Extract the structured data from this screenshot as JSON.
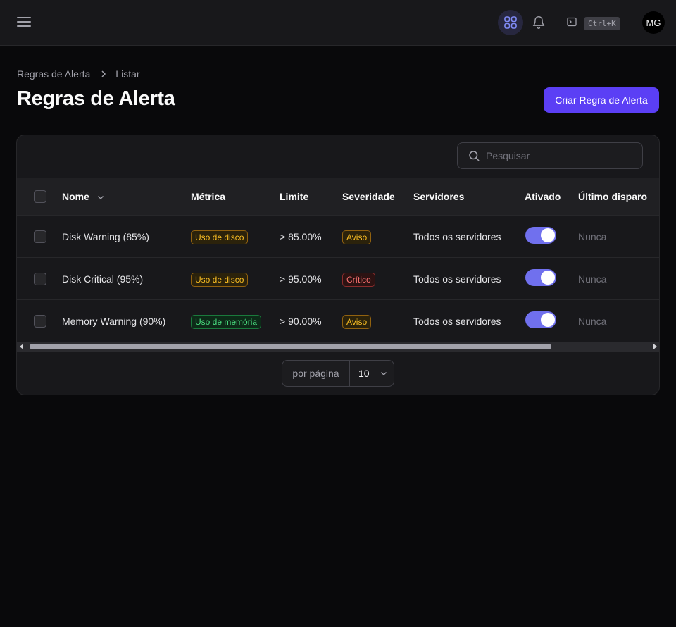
{
  "topbar": {
    "shortcut": "Ctrl+K",
    "avatar_initials": "MG"
  },
  "breadcrumb": [
    "Regras de Alerta",
    "Listar"
  ],
  "page": {
    "title": "Regras de Alerta",
    "create_label": "Criar Regra de Alerta"
  },
  "table": {
    "search_placeholder": "Pesquisar",
    "columns": {
      "name": "Nome",
      "metric": "Métrica",
      "limit": "Limite",
      "severity": "Severidade",
      "servers": "Servidores",
      "enabled": "Ativado",
      "last_triggered": "Último disparo"
    },
    "rows": [
      {
        "name": "Disk Warning (85%)",
        "metric": "Uso de disco",
        "metric_style": "warn",
        "limit": "> 85.00%",
        "severity": "Aviso",
        "severity_style": "warn",
        "servers": "Todos os servidores",
        "enabled": true,
        "last_triggered": "Nunca"
      },
      {
        "name": "Disk Critical (95%)",
        "metric": "Uso de disco",
        "metric_style": "warn",
        "limit": "> 95.00%",
        "severity": "Crítico",
        "severity_style": "danger",
        "servers": "Todos os servidores",
        "enabled": true,
        "last_triggered": "Nunca"
      },
      {
        "name": "Memory Warning (90%)",
        "metric": "Uso de memória",
        "metric_style": "success",
        "limit": "> 90.00%",
        "severity": "Aviso",
        "severity_style": "warn",
        "servers": "Todos os servidores",
        "enabled": true,
        "last_triggered": "Nunca"
      }
    ]
  },
  "pagination": {
    "per_page_label": "por página",
    "per_page_value": "10"
  },
  "colors": {
    "accent": "#5b3ff5",
    "toggle_on": "#7070ee",
    "background": "#09090b",
    "surface": "#18181b"
  },
  "icons": {
    "menu": "hamburger-icon",
    "apps": "grid-icon",
    "notifications": "bell-icon",
    "command": "terminal-icon",
    "breadcrumb_separator": "chevron-right-icon",
    "search": "search-icon",
    "sort": "chevron-down-icon"
  }
}
